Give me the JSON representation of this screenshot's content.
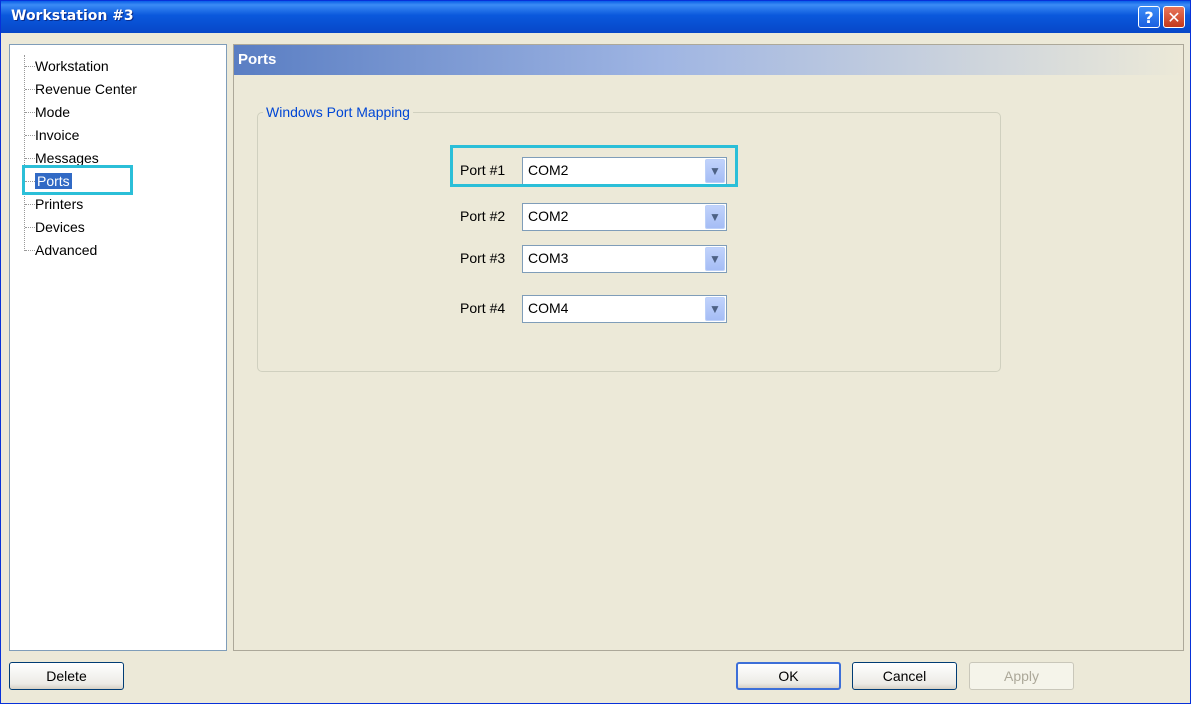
{
  "window": {
    "title": "Workstation #3"
  },
  "titlebar": {
    "help_glyph": "?",
    "close_glyph": "✕"
  },
  "tree": {
    "items": [
      {
        "label": "Workstation"
      },
      {
        "label": "Revenue Center"
      },
      {
        "label": "Mode"
      },
      {
        "label": "Invoice"
      },
      {
        "label": "Messages"
      },
      {
        "label": "Ports",
        "selected": true
      },
      {
        "label": "Printers"
      },
      {
        "label": "Devices"
      },
      {
        "label": "Advanced"
      }
    ]
  },
  "panel": {
    "title": "Ports",
    "group": {
      "legend": "Windows Port Mapping",
      "ports": [
        {
          "label": "Port #1",
          "value": "COM2"
        },
        {
          "label": "Port #2",
          "value": "COM2"
        },
        {
          "label": "Port #3",
          "value": "COM3"
        },
        {
          "label": "Port #4",
          "value": "COM4"
        }
      ]
    }
  },
  "buttons": {
    "delete": "Delete",
    "ok": "OK",
    "cancel": "Cancel",
    "apply": "Apply"
  },
  "icons": {
    "dropdown_arrow": "chevron-down-icon"
  },
  "colors": {
    "titlebar": "#0a58dc",
    "highlight": "#2bbfd8",
    "selection": "#316ac5",
    "legend": "#0046d5"
  }
}
